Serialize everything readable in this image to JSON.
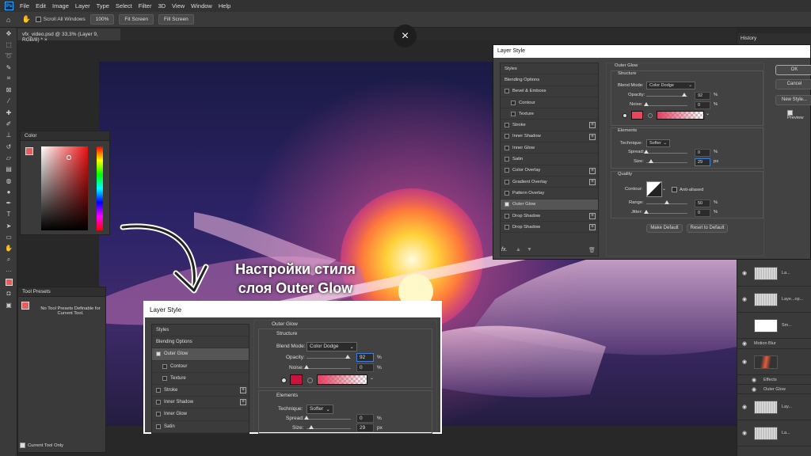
{
  "app": {
    "logo": "Ps",
    "menu": [
      "File",
      "Edit",
      "Image",
      "Layer",
      "Type",
      "Select",
      "Filter",
      "3D",
      "View",
      "Window",
      "Help"
    ]
  },
  "options_bar": {
    "scroll_all_windows": "Scroll All Windows",
    "zoom": "100%",
    "fit_screen": "Fit Screen",
    "fill_screen": "Fill Screen"
  },
  "document": {
    "tab_title": "vfx_video.psd @ 33,3% (Layer 9, RGB/8) *"
  },
  "close_icon": "×",
  "color_panel": {
    "title": "Color"
  },
  "tool_presets": {
    "title": "Tool Presets",
    "message": "No Tool Presets Definable for Current Tool.",
    "current_tool_only": "Current Tool Only"
  },
  "history_panel": {
    "title": "History"
  },
  "layers": [
    {
      "name": "La..."
    },
    {
      "name": "Laye...op..."
    },
    {
      "name": "Sm..."
    },
    {
      "name": "Motion Blur"
    },
    {
      "name": ""
    },
    {
      "name": "Effects"
    },
    {
      "name": "Outer Glow"
    },
    {
      "name": "Lay..."
    },
    {
      "name": "La..."
    }
  ],
  "layer_style": {
    "title": "Layer Style",
    "styles": [
      {
        "label": "Styles",
        "cb": false,
        "plus": false,
        "sub": false,
        "header": true
      },
      {
        "label": "Blending Options",
        "cb": false,
        "plus": false,
        "sub": false,
        "header": true
      },
      {
        "label": "Bevel & Emboss",
        "cb": true,
        "plus": false,
        "sub": false
      },
      {
        "label": "Contour",
        "cb": true,
        "plus": false,
        "sub": true
      },
      {
        "label": "Texture",
        "cb": true,
        "plus": false,
        "sub": true
      },
      {
        "label": "Stroke",
        "cb": true,
        "plus": true,
        "sub": false
      },
      {
        "label": "Inner Shadow",
        "cb": true,
        "plus": true,
        "sub": false
      },
      {
        "label": "Inner Glow",
        "cb": true,
        "plus": false,
        "sub": false
      },
      {
        "label": "Satin",
        "cb": true,
        "plus": false,
        "sub": false
      },
      {
        "label": "Color Overlay",
        "cb": true,
        "plus": true,
        "sub": false
      },
      {
        "label": "Gradient Overlay",
        "cb": true,
        "plus": true,
        "sub": false
      },
      {
        "label": "Pattern Overlay",
        "cb": true,
        "plus": false,
        "sub": false
      },
      {
        "label": "Outer Glow",
        "cb": true,
        "plus": false,
        "sub": false,
        "selected": true
      },
      {
        "label": "Drop Shadow",
        "cb": true,
        "plus": true,
        "sub": false
      },
      {
        "label": "Drop Shadow",
        "cb": true,
        "plus": true,
        "sub": false
      }
    ],
    "fx": "fx.",
    "outer_glow": {
      "section": "Outer Glow",
      "structure": "Structure",
      "blend_mode_label": "Blend Mode:",
      "blend_mode": "Color Dodge",
      "opacity_label": "Opacity:",
      "opacity": "92",
      "opacity_pct": 92,
      "noise_label": "Noise:",
      "noise": "0",
      "noise_pct": 0,
      "percent": "%",
      "px": "px",
      "elements": "Elements",
      "technique_label": "Technique:",
      "technique": "Softer",
      "spread_label": "Spread:",
      "spread": "0",
      "spread_pct": 0,
      "size_label": "Size:",
      "size": "29",
      "size_pct": 11,
      "quality": "Quality",
      "contour_label": "Contour:",
      "anti_aliased": "Anti-aliased",
      "range_label": "Range:",
      "range": "50",
      "range_pct": 50,
      "jitter_label": "Jitter:",
      "jitter": "0",
      "jitter_pct": 0,
      "make_default": "Make Default",
      "reset_default": "Reset to Default",
      "glow_color": "#e8465f"
    },
    "buttons": {
      "ok": "OK",
      "cancel": "Cancel",
      "new_style": "New Style...",
      "preview": "Preview"
    }
  },
  "zoom_callout": {
    "title": "Layer Style",
    "styles": [
      "Styles",
      "Blending Options",
      "Outer Glow",
      "Contour",
      "Texture",
      "Stroke",
      "Inner Shadow",
      "Inner Glow",
      "Satin"
    ],
    "glow_color": "#c8143f"
  },
  "annotation": {
    "line1": "Настройки стиля",
    "line2": "слоя Outer Glow"
  }
}
